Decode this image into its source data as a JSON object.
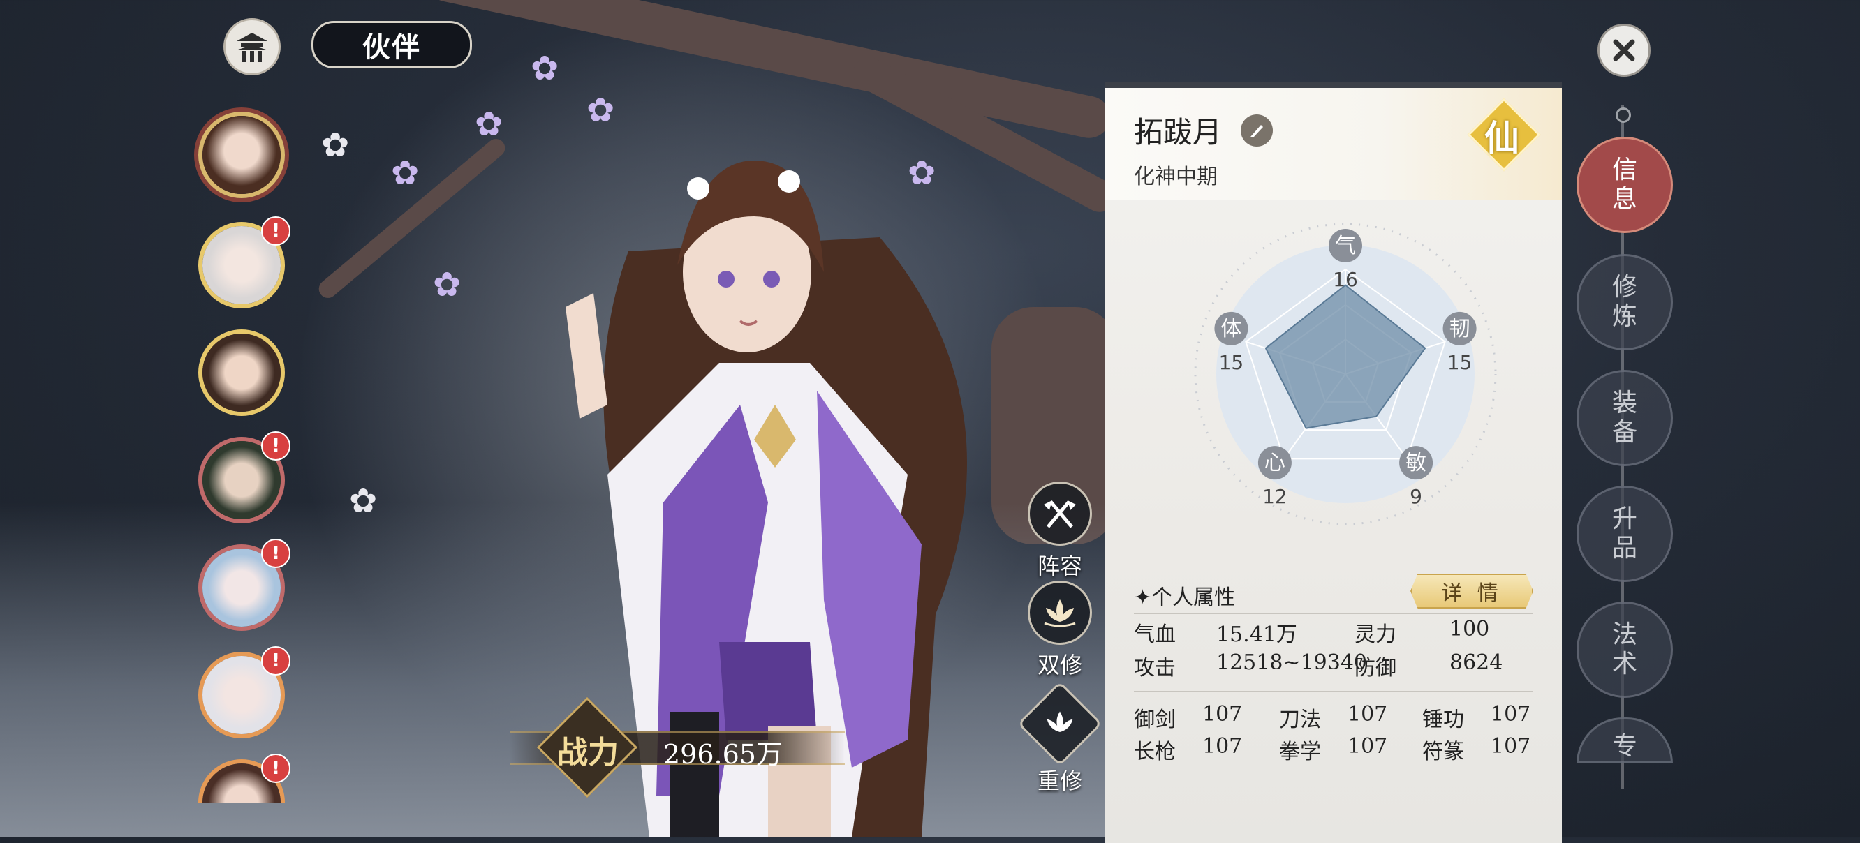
{
  "header": {
    "title": "伙伴"
  },
  "roster": [
    {
      "selected": true,
      "alert": false,
      "ring": "red"
    },
    {
      "selected": false,
      "alert": true,
      "ring": "gold"
    },
    {
      "selected": false,
      "alert": false,
      "ring": "gold"
    },
    {
      "selected": false,
      "alert": true,
      "ring": "red"
    },
    {
      "selected": false,
      "alert": true,
      "ring": "red"
    },
    {
      "selected": false,
      "alert": true,
      "ring": "orange"
    },
    {
      "selected": false,
      "alert": true,
      "ring": "orange"
    }
  ],
  "alert_glyph": "!",
  "actions": {
    "lineup": "阵容",
    "dual_cultivation": "双修",
    "recultivate": "重修"
  },
  "power": {
    "label": "战力",
    "value": "296.65万"
  },
  "character": {
    "name": "拓跋月",
    "tier": "仙",
    "realm": "化神中期"
  },
  "attributes": {
    "qi": {
      "label": "气",
      "value": "16"
    },
    "ren": {
      "label": "韧",
      "value": "15"
    },
    "min": {
      "label": "敏",
      "value": "9"
    },
    "xin": {
      "label": "心",
      "value": "12"
    },
    "ti": {
      "label": "体",
      "value": "15"
    }
  },
  "radar_levels": {
    "qi": 0.85,
    "ren": 0.8,
    "min": 0.5,
    "xin": 0.64,
    "ti": 0.8
  },
  "personal": {
    "title": "个人属性",
    "detail_button": "详 情",
    "stats": [
      {
        "label": "气血",
        "value": "15.41万"
      },
      {
        "label": "灵力",
        "value": "100"
      },
      {
        "label": "攻击",
        "value": "12518~19340"
      },
      {
        "label": "防御",
        "value": "8624"
      }
    ],
    "skills": [
      {
        "label": "御剑",
        "value": "107"
      },
      {
        "label": "刀法",
        "value": "107"
      },
      {
        "label": "锤功",
        "value": "107"
      },
      {
        "label": "长枪",
        "value": "107"
      },
      {
        "label": "拳学",
        "value": "107"
      },
      {
        "label": "符篆",
        "value": "107"
      }
    ]
  },
  "tabs": [
    {
      "label": "信息",
      "active": true
    },
    {
      "label": "修炼",
      "active": false
    },
    {
      "label": "装备",
      "active": false
    },
    {
      "label": "升品",
      "active": false
    },
    {
      "label": "法术",
      "active": false
    },
    {
      "label": "专",
      "active": false
    }
  ],
  "colors": {
    "active_tab": "#a24a4a",
    "tier_gold": "#e7bf3e",
    "alert_red": "#d84040",
    "radar_fill": "#6f8ea8"
  },
  "icons": {
    "home": "pavilion-icon",
    "close": "close-icon",
    "edit": "brush-icon",
    "lineup": "crossed-banners-icon",
    "dual": "lotus-icon",
    "recultivate": "lotus-icon",
    "section": "four-point-star-icon"
  }
}
